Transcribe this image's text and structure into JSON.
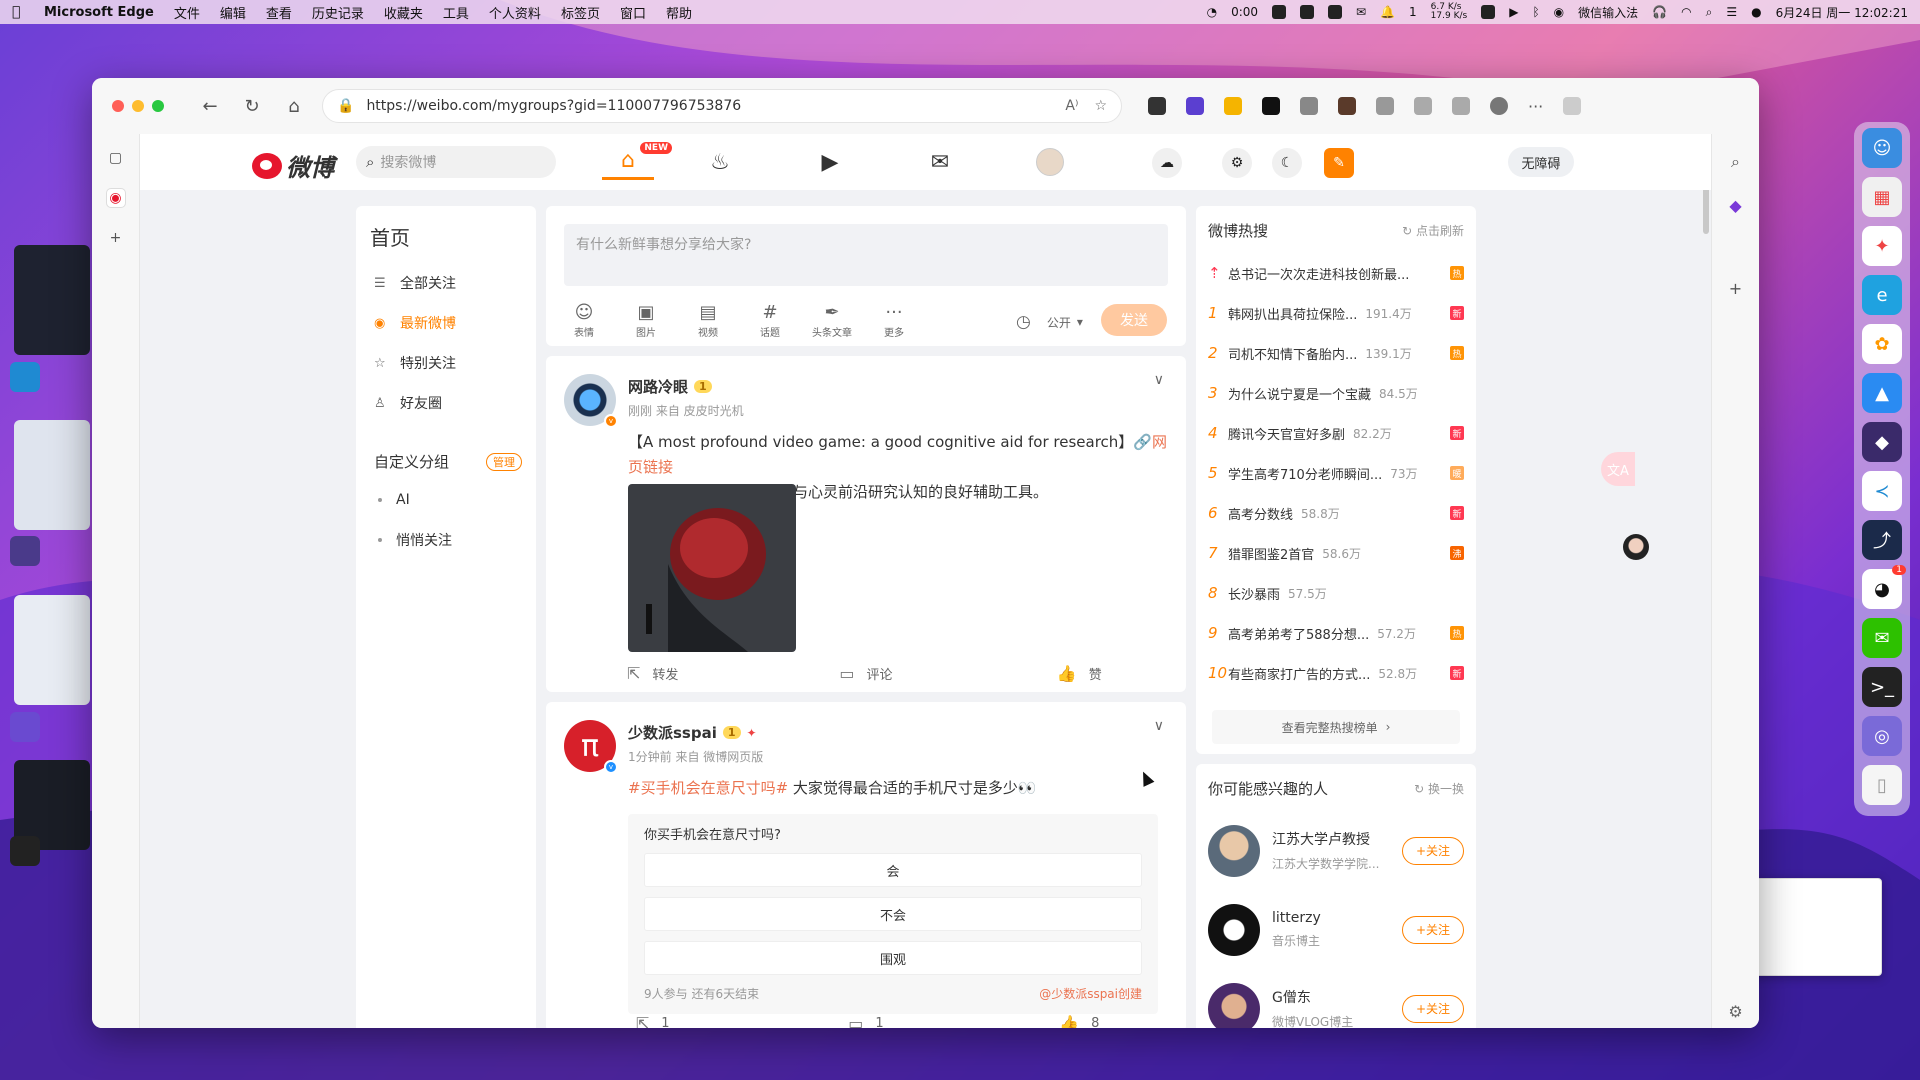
{
  "menubar": {
    "app_name": "Microsoft Edge",
    "items": [
      "文件",
      "编辑",
      "查看",
      "历史记录",
      "收藏夹",
      "工具",
      "个人资料",
      "标签页",
      "窗口",
      "帮助"
    ],
    "timer": "0:00",
    "net_up": "6.7 K/s",
    "net_down": "17.9 K/s",
    "notif_count": "1",
    "input_method": "微信输入法",
    "datetime": "6月24日 周一  12:02:21"
  },
  "browser": {
    "url": "https://weibo.com/mygroups?gid=110007796753876"
  },
  "header": {
    "logo_text": "微博",
    "search_placeholder": "搜索微博",
    "new_badge": "NEW",
    "accessibility_label": "无障碍"
  },
  "leftnav": {
    "title": "首页",
    "items": [
      {
        "label": "全部关注",
        "icon": "list-icon"
      },
      {
        "label": "最新微博",
        "icon": "clock-icon",
        "active": true
      },
      {
        "label": "特别关注",
        "icon": "user-star-icon"
      },
      {
        "label": "好友圈",
        "icon": "user-icon"
      }
    ],
    "group_title": "自定义分组",
    "manage_label": "管理",
    "groups": [
      "AI",
      "悄悄关注"
    ]
  },
  "compose": {
    "placeholder": "有什么新鲜事想分享给大家?",
    "tools": [
      "表情",
      "图片",
      "视频",
      "话题",
      "头条文章",
      "更多"
    ],
    "visibility": "公开",
    "send_label": "发送"
  },
  "posts": [
    {
      "author": "网路冷眼",
      "level": "1",
      "meta": "刚刚 来自 皮皮时光机",
      "text_en": "【A most profound video game: a good cognitive aid for research】",
      "link_label": "网页链接",
      "text_zh": "最深刻的电子游戏：生命与心灵前沿研究认知的良好辅助工具。",
      "actions": {
        "repost": "转发",
        "comment": "评论",
        "like": "赞"
      }
    },
    {
      "author": "少数派sspai",
      "level": "1",
      "meta": "1分钟前 来自 微博网页版",
      "topic": "#买手机会在意尺寸吗#",
      "text": " 大家觉得最合适的手机尺寸是多少👀",
      "poll": {
        "question": "你买手机会在意尺寸吗?",
        "options": [
          "会",
          "不会",
          "围观"
        ],
        "status": "9人参与 还有6天结束",
        "creator": "@少数派sspai创建"
      },
      "actions": {
        "repost": "1",
        "comment": "1",
        "like": "8"
      }
    }
  ],
  "hot": {
    "title": "微博热搜",
    "refresh": "点击刷新",
    "pinned": {
      "title": "总书记一次次走进科技创新最...",
      "tag": "热",
      "tag_color": "#ff9406"
    },
    "items": [
      {
        "rank": "1",
        "title": "韩网扒出具荷拉保险...",
        "count": "191.4万",
        "tag": "新",
        "tag_color": "#ff3852"
      },
      {
        "rank": "2",
        "title": "司机不知情下备胎内...",
        "count": "139.1万",
        "tag": "热",
        "tag_color": "#ff9406"
      },
      {
        "rank": "3",
        "title": "为什么说宁夏是一个宝藏",
        "count": "84.5万",
        "tag": "",
        "tag_color": ""
      },
      {
        "rank": "4",
        "title": "腾讯今天官宣好多剧",
        "count": "82.2万",
        "tag": "新",
        "tag_color": "#ff3852"
      },
      {
        "rank": "5",
        "title": "学生高考710分老师瞬间...",
        "count": "73万",
        "tag": "暖",
        "tag_color": "#ffab5a"
      },
      {
        "rank": "6",
        "title": "高考分数线",
        "count": "58.8万",
        "tag": "新",
        "tag_color": "#ff3852"
      },
      {
        "rank": "7",
        "title": "猎罪图鉴2首官",
        "count": "58.6万",
        "tag": "沸",
        "tag_color": "#f86400"
      },
      {
        "rank": "8",
        "title": "长沙暴雨",
        "count": "57.5万",
        "tag": "",
        "tag_color": ""
      },
      {
        "rank": "9",
        "title": "高考弟弟考了588分想...",
        "count": "57.2万",
        "tag": "热",
        "tag_color": "#ff9406"
      },
      {
        "rank": "10",
        "title": "有些商家打广告的方式...",
        "count": "52.8万",
        "tag": "新",
        "tag_color": "#ff3852"
      }
    ],
    "more_label": "查看完整热搜榜单"
  },
  "recommend": {
    "title": "你可能感兴趣的人",
    "swap_label": "换一换",
    "follow_label": "+关注",
    "people": [
      {
        "name": "江苏大学卢教授",
        "desc": "江苏大学数学学院..."
      },
      {
        "name": "litterzy",
        "desc": "音乐博主"
      },
      {
        "name": "G僧东",
        "desc": "微博VLOG博主"
      }
    ]
  },
  "colors": {
    "accent": "#ff8200",
    "weibo_red": "#e6162d",
    "link": "#eb7350"
  }
}
